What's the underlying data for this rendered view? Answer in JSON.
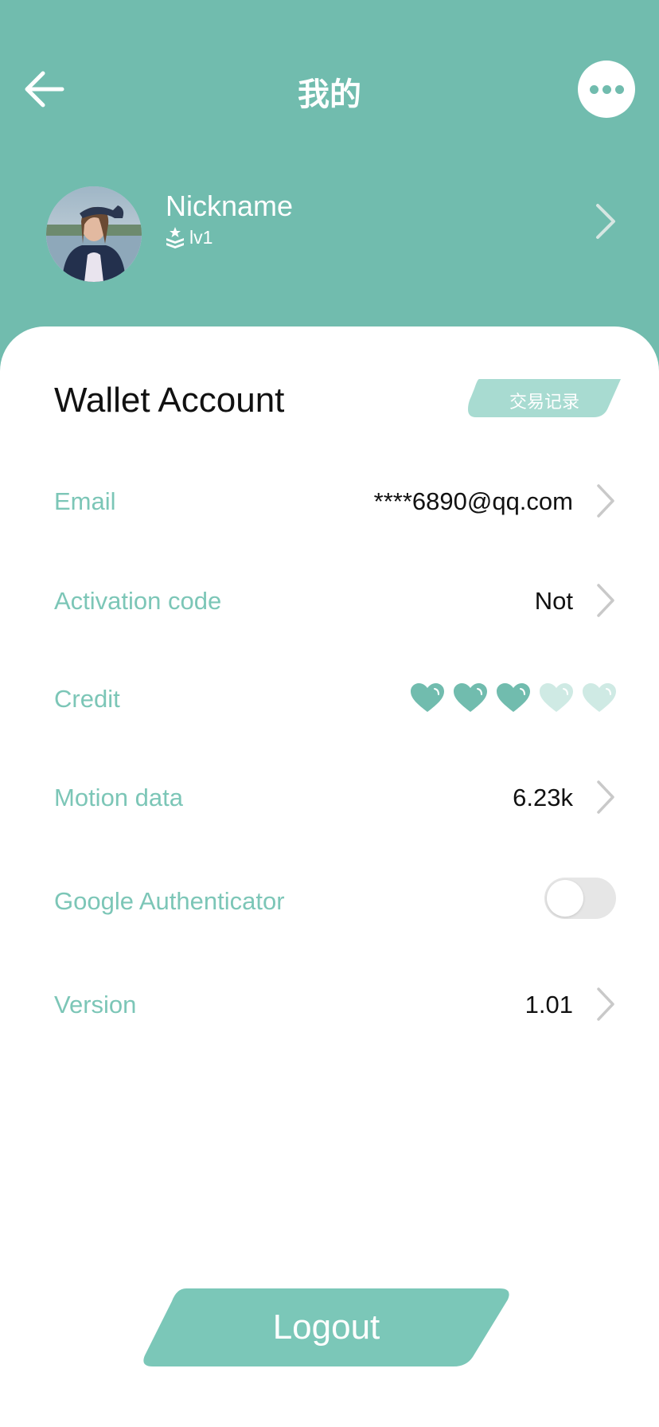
{
  "header": {
    "title": "我的",
    "back_icon": "arrow-left-icon",
    "more_icon": "more-dots-icon",
    "background_color": "#71BCAE"
  },
  "profile": {
    "nickname": "Nickname",
    "level": "lv1",
    "level_icon": "rank-badge-icon"
  },
  "wallet": {
    "title": "Wallet Account",
    "transactions_button": "交易记录"
  },
  "rows": {
    "email": {
      "label": "Email",
      "value": "****6890@qq.com"
    },
    "activation": {
      "label": "Activation code",
      "value": "Not"
    },
    "credit": {
      "label": "Credit",
      "rating": 3,
      "max": 5
    },
    "motion": {
      "label": "Motion data",
      "value": "6.23k"
    },
    "google_auth": {
      "label": "Google Authenticator",
      "enabled": false
    },
    "version": {
      "label": "Version",
      "value": "1.01"
    }
  },
  "logout": {
    "label": "Logout"
  },
  "colors": {
    "accent": "#71BCAE",
    "label": "#7CC6B7",
    "heart_filled": "#71BCAE",
    "heart_empty": "#CFEAE4"
  }
}
